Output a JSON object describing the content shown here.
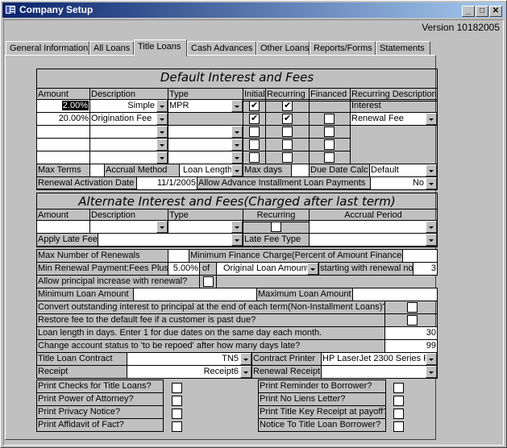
{
  "window": {
    "title": "Company Setup",
    "minimize": "_",
    "maximize": "□",
    "close": "✕"
  },
  "version": "Version 10182005",
  "tabs": [
    "General Information",
    "All Loans",
    "Title Loans",
    "Cash Advances",
    "Other Loans",
    "Reports/Forms",
    "Statements"
  ],
  "active_tab": "Title Loans",
  "default": {
    "title": "Default Interest and Fees",
    "headers": {
      "amount": "Amount",
      "description": "Description",
      "type": "Type",
      "initial": "Initial",
      "recurring": "Recurring",
      "financed": "Financed",
      "recurring_description": "Recurring Description"
    },
    "rows": [
      {
        "amount": "2.00%",
        "description": "Simple",
        "type": "MPR",
        "initial": true,
        "recurring": true,
        "financed": null,
        "recurring_description": "Interest"
      },
      {
        "amount": "20.00%",
        "description": "Origination Fee",
        "type": "",
        "initial": true,
        "recurring": true,
        "financed": false,
        "recurring_description": "Renewal Fee"
      },
      {
        "amount": "",
        "description": "",
        "type": "",
        "initial": false,
        "recurring": false,
        "financed": false
      },
      {
        "amount": "",
        "description": "",
        "type": "",
        "initial": false,
        "recurring": false,
        "financed": false
      },
      {
        "amount": "",
        "description": "",
        "type": "",
        "initial": false,
        "recurring": false,
        "financed": false
      }
    ],
    "max_terms_label": "Max Terms",
    "max_terms": "",
    "accrual_method_label": "Accrual Method",
    "accrual_method": "Loan Length",
    "max_days_label": "Max days",
    "max_days": "",
    "due_date_calc_label": "Due Date Calc",
    "due_date_calc": "Default",
    "renewal_activation_label": "Renewal Activation Date",
    "renewal_activation": "11/1/2005",
    "allow_advance_label": "Allow Advance Installment Loan Payments",
    "allow_advance": "No"
  },
  "alternate": {
    "title": "Alternate Interest and Fees(Charged after last term)",
    "headers": {
      "amount": "Amount",
      "description": "Description",
      "type": "Type",
      "recurring": "Recurring",
      "accrual_period": "Accrual Period"
    },
    "apply_late_fee_label": "Apply Late Fee",
    "late_fee_type_label": "Late Fee Type"
  },
  "renewals": {
    "max_renewals_label": "Max Number of Renewals",
    "max_renewals": "",
    "min_finance_label": "Minimum Finance Charge(Percent of Amount Financed)",
    "min_finance": "",
    "min_renewal_label": "Min Renewal Payment:Fees Plus",
    "min_renewal_pct": "5.00%",
    "of_label": "of",
    "min_renewal_basis": "Original Loan Amount",
    "starting_label": "starting with renewal no.",
    "starting_no": "3",
    "allow_principal_label": "Allow principal increase with renewal?",
    "min_loan_label": "Minimum Loan Amount",
    "min_loan": "",
    "max_loan_label": "Maximum Loan Amount",
    "max_loan": "",
    "convert_label": "Convert outstanding interest to principal at the end of each term(Non-Installment Loans)?",
    "restore_label": "Restore fee to the default fee if a customer is past due?",
    "loan_length_label": "Loan length in days. Enter 1 for due dates on the same day each month.",
    "loan_length": "30",
    "repo_label": "Change account status to 'to be repoed' after how many days late?",
    "repo_days": "99"
  },
  "contracts": {
    "title_contract_label": "Title Loan Contract",
    "title_contract": "TN5",
    "printer_label": "Contract Printer",
    "printer": "HP LaserJet 2300 Series F",
    "receipt_label": "Receipt",
    "receipt": "Receipt6",
    "renewal_receipt_label": "Renewal Receipt",
    "renewal_receipt": ""
  },
  "print_left": [
    "Print Checks for Title Loans?",
    "Print Power of Attorney?",
    "Print Privacy Notice?",
    "Print Affidavit of Fact?"
  ],
  "print_right": [
    "Print Reminder to Borrower?",
    "Print No Liens Letter?",
    "Print Title Key Receipt at payoff?",
    "Notice To Title Loan Borrower?"
  ]
}
